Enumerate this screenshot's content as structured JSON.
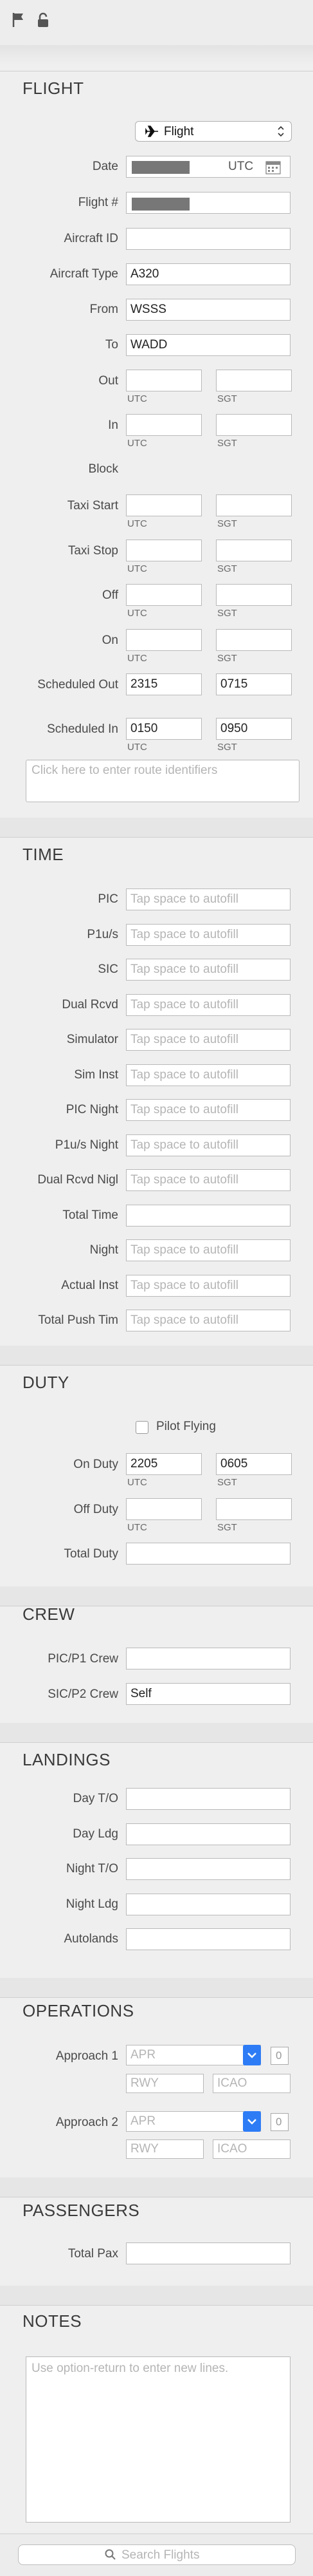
{
  "toolbar": {
    "flag_icon": "flag-icon",
    "lock_icon": "lock-icon"
  },
  "flight": {
    "heading": "FLIGHT",
    "type_popup": "Flight",
    "date_label": "Date",
    "date_tz": "UTC",
    "flight_no_label": "Flight #",
    "aircraft_id_label": "Aircraft ID",
    "aircraft_type_label": "Aircraft Type",
    "aircraft_type_value": "A320",
    "from_label": "From",
    "from_value": "WSSS",
    "to_label": "To",
    "to_value": "WADD",
    "out_label": "Out",
    "in_label": "In",
    "block_label": "Block",
    "taxi_start_label": "Taxi Start",
    "taxi_stop_label": "Taxi Stop",
    "off_label": "Off",
    "on_label": "On",
    "sched_out_label": "Scheduled Out",
    "sched_out_utc": "2315",
    "sched_out_local": "0715",
    "sched_in_label": "Scheduled In",
    "sched_in_utc": "0150",
    "sched_in_local": "0950",
    "utc": "UTC",
    "sgt": "SGT",
    "route_placeholder": "Click here to enter route identifiers"
  },
  "time": {
    "heading": "TIME",
    "placeholder": "Tap space to autofill",
    "rows": [
      "PIC",
      "P1u/s",
      "SIC",
      "Dual Rcvd",
      "Simulator",
      "Sim Inst",
      "PIC Night",
      "P1u/s Night",
      "Dual Rcvd Nigl",
      "Total Time",
      "Night",
      "Actual Inst",
      "Total Push Tim"
    ]
  },
  "duty": {
    "heading": "DUTY",
    "pilot_flying": "Pilot Flying",
    "on_duty_label": "On Duty",
    "on_duty_utc": "2205",
    "on_duty_local": "0605",
    "off_duty_label": "Off Duty",
    "total_duty_label": "Total Duty",
    "utc": "UTC",
    "sgt": "SGT"
  },
  "crew": {
    "heading": "CREW",
    "pic_label": "PIC/P1 Crew",
    "sic_label": "SIC/P2 Crew",
    "sic_value": "Self"
  },
  "landings": {
    "heading": "LANDINGS",
    "rows": [
      "Day T/O",
      "Day Ldg",
      "Night T/O",
      "Night Ldg",
      "Autolands"
    ]
  },
  "operations": {
    "heading": "OPERATIONS",
    "approach1_label": "Approach 1",
    "approach2_label": "Approach 2",
    "apr_placeholder": "APR",
    "count": "0",
    "rwy_placeholder": "RWY",
    "icao_placeholder": "ICAO"
  },
  "passengers": {
    "heading": "PASSENGERS",
    "total_pax_label": "Total Pax"
  },
  "notes": {
    "heading": "NOTES",
    "placeholder": "Use option-return to enter new lines."
  },
  "search": {
    "placeholder": "Search Flights"
  }
}
